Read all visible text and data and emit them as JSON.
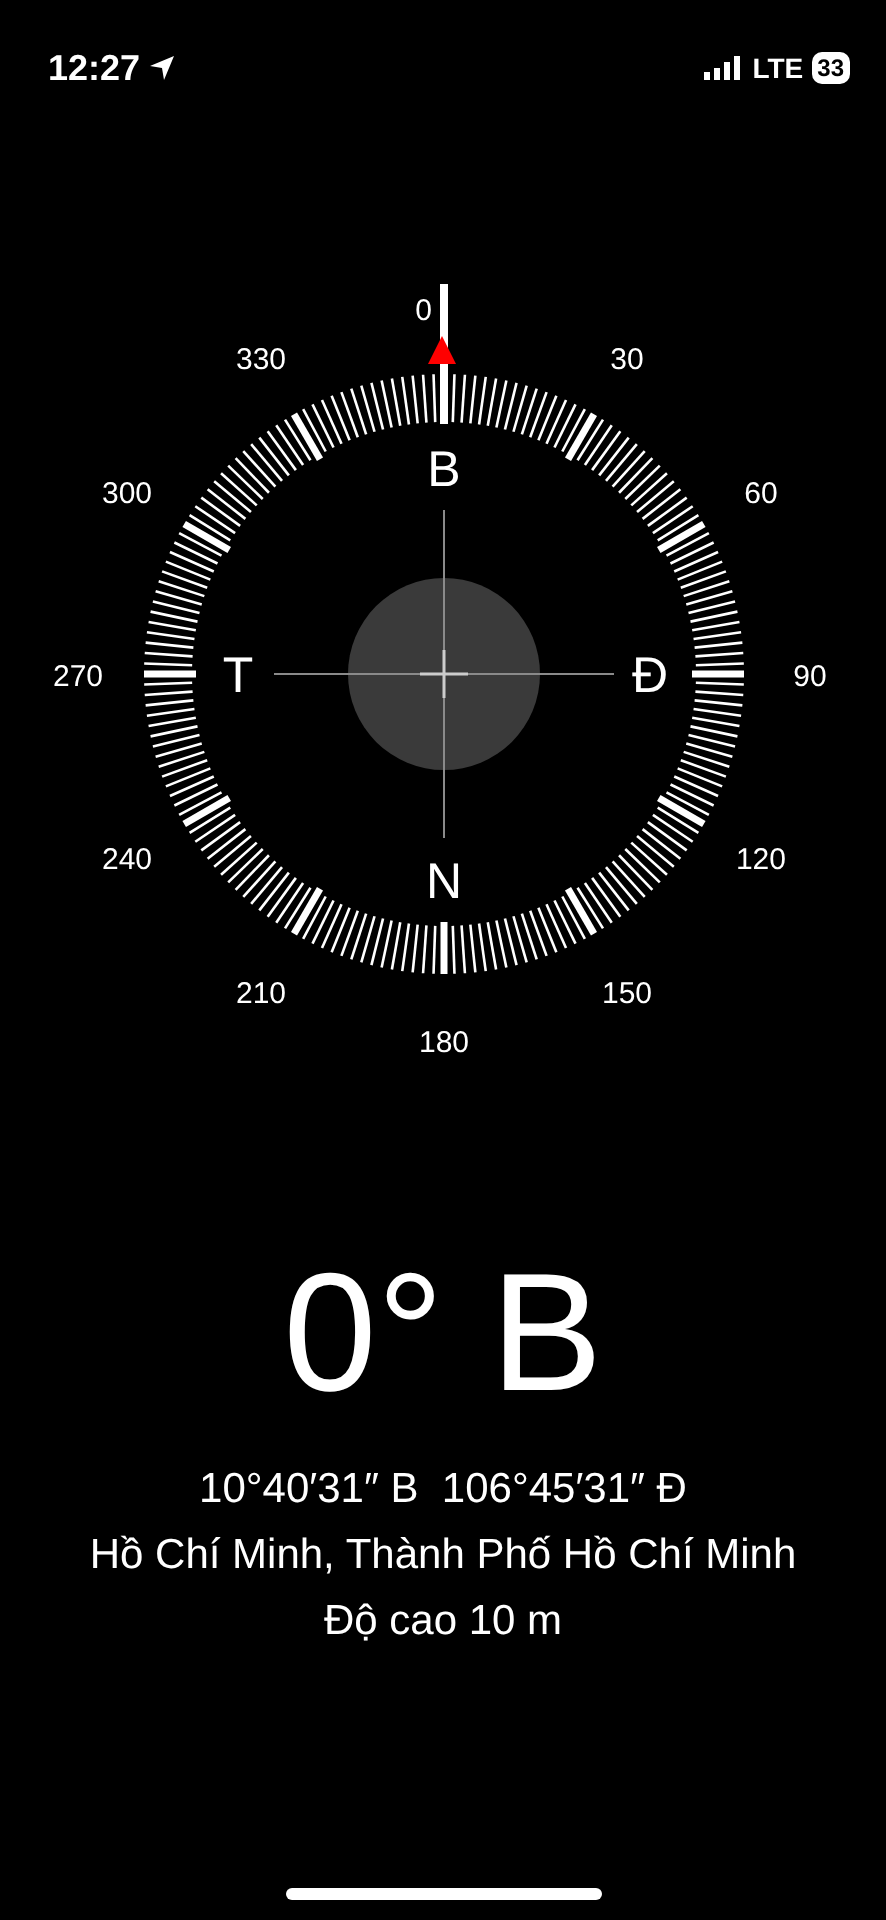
{
  "status_bar": {
    "time": "12:27",
    "network": "LTE",
    "battery": "33"
  },
  "compass": {
    "degree_labels": [
      "0",
      "30",
      "60",
      "90",
      "120",
      "150",
      "180",
      "210",
      "240",
      "270",
      "300",
      "330"
    ],
    "cardinals": [
      "B",
      "Đ",
      "N",
      "T"
    ]
  },
  "heading": "0° B",
  "coordinates": "10°40′31″ B  106°45′31″ Đ",
  "location": "Hồ Chí Minh, Thành Phố Hồ Chí Minh",
  "altitude": "Độ cao 10 m"
}
